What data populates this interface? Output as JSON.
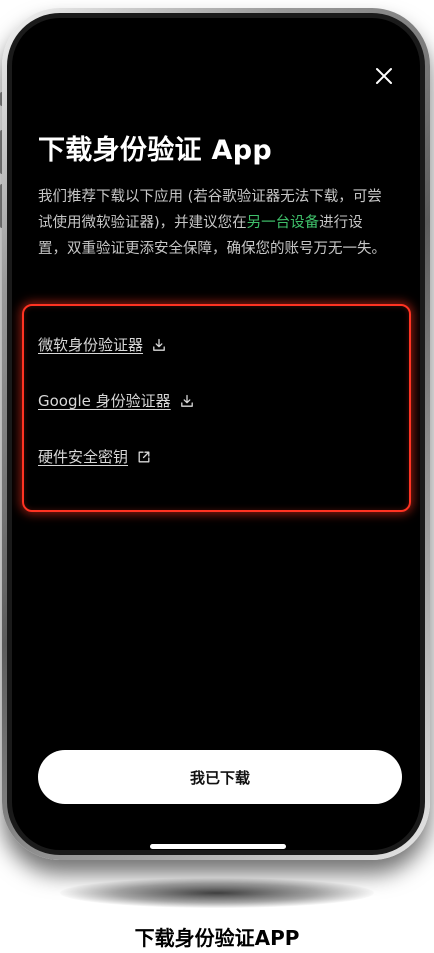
{
  "screen": {
    "close_icon": "close-icon",
    "title": "下载身份验证 App",
    "description": {
      "before_link": "我们推荐下载以下应用 (若谷歌验证器无法下载，可尝试使用微软验证器)，并建议您在",
      "link_text": "另一台设备",
      "after_link": "进行设置，双重验证更添安全保障，确保您的账号万无一失。"
    },
    "apps": [
      {
        "label": "微软身份验证器",
        "icon": "download-icon"
      },
      {
        "label": "Google 身份验证器",
        "icon": "download-icon"
      },
      {
        "label": "硬件安全密钥",
        "icon": "external-link-icon"
      }
    ],
    "primary_button": "我已下载"
  },
  "caption": "下载身份验证APP",
  "colors": {
    "background": "#000000",
    "link_green": "#3fc06a",
    "highlight_red": "#ff3322",
    "button_bg": "#ffffff"
  }
}
